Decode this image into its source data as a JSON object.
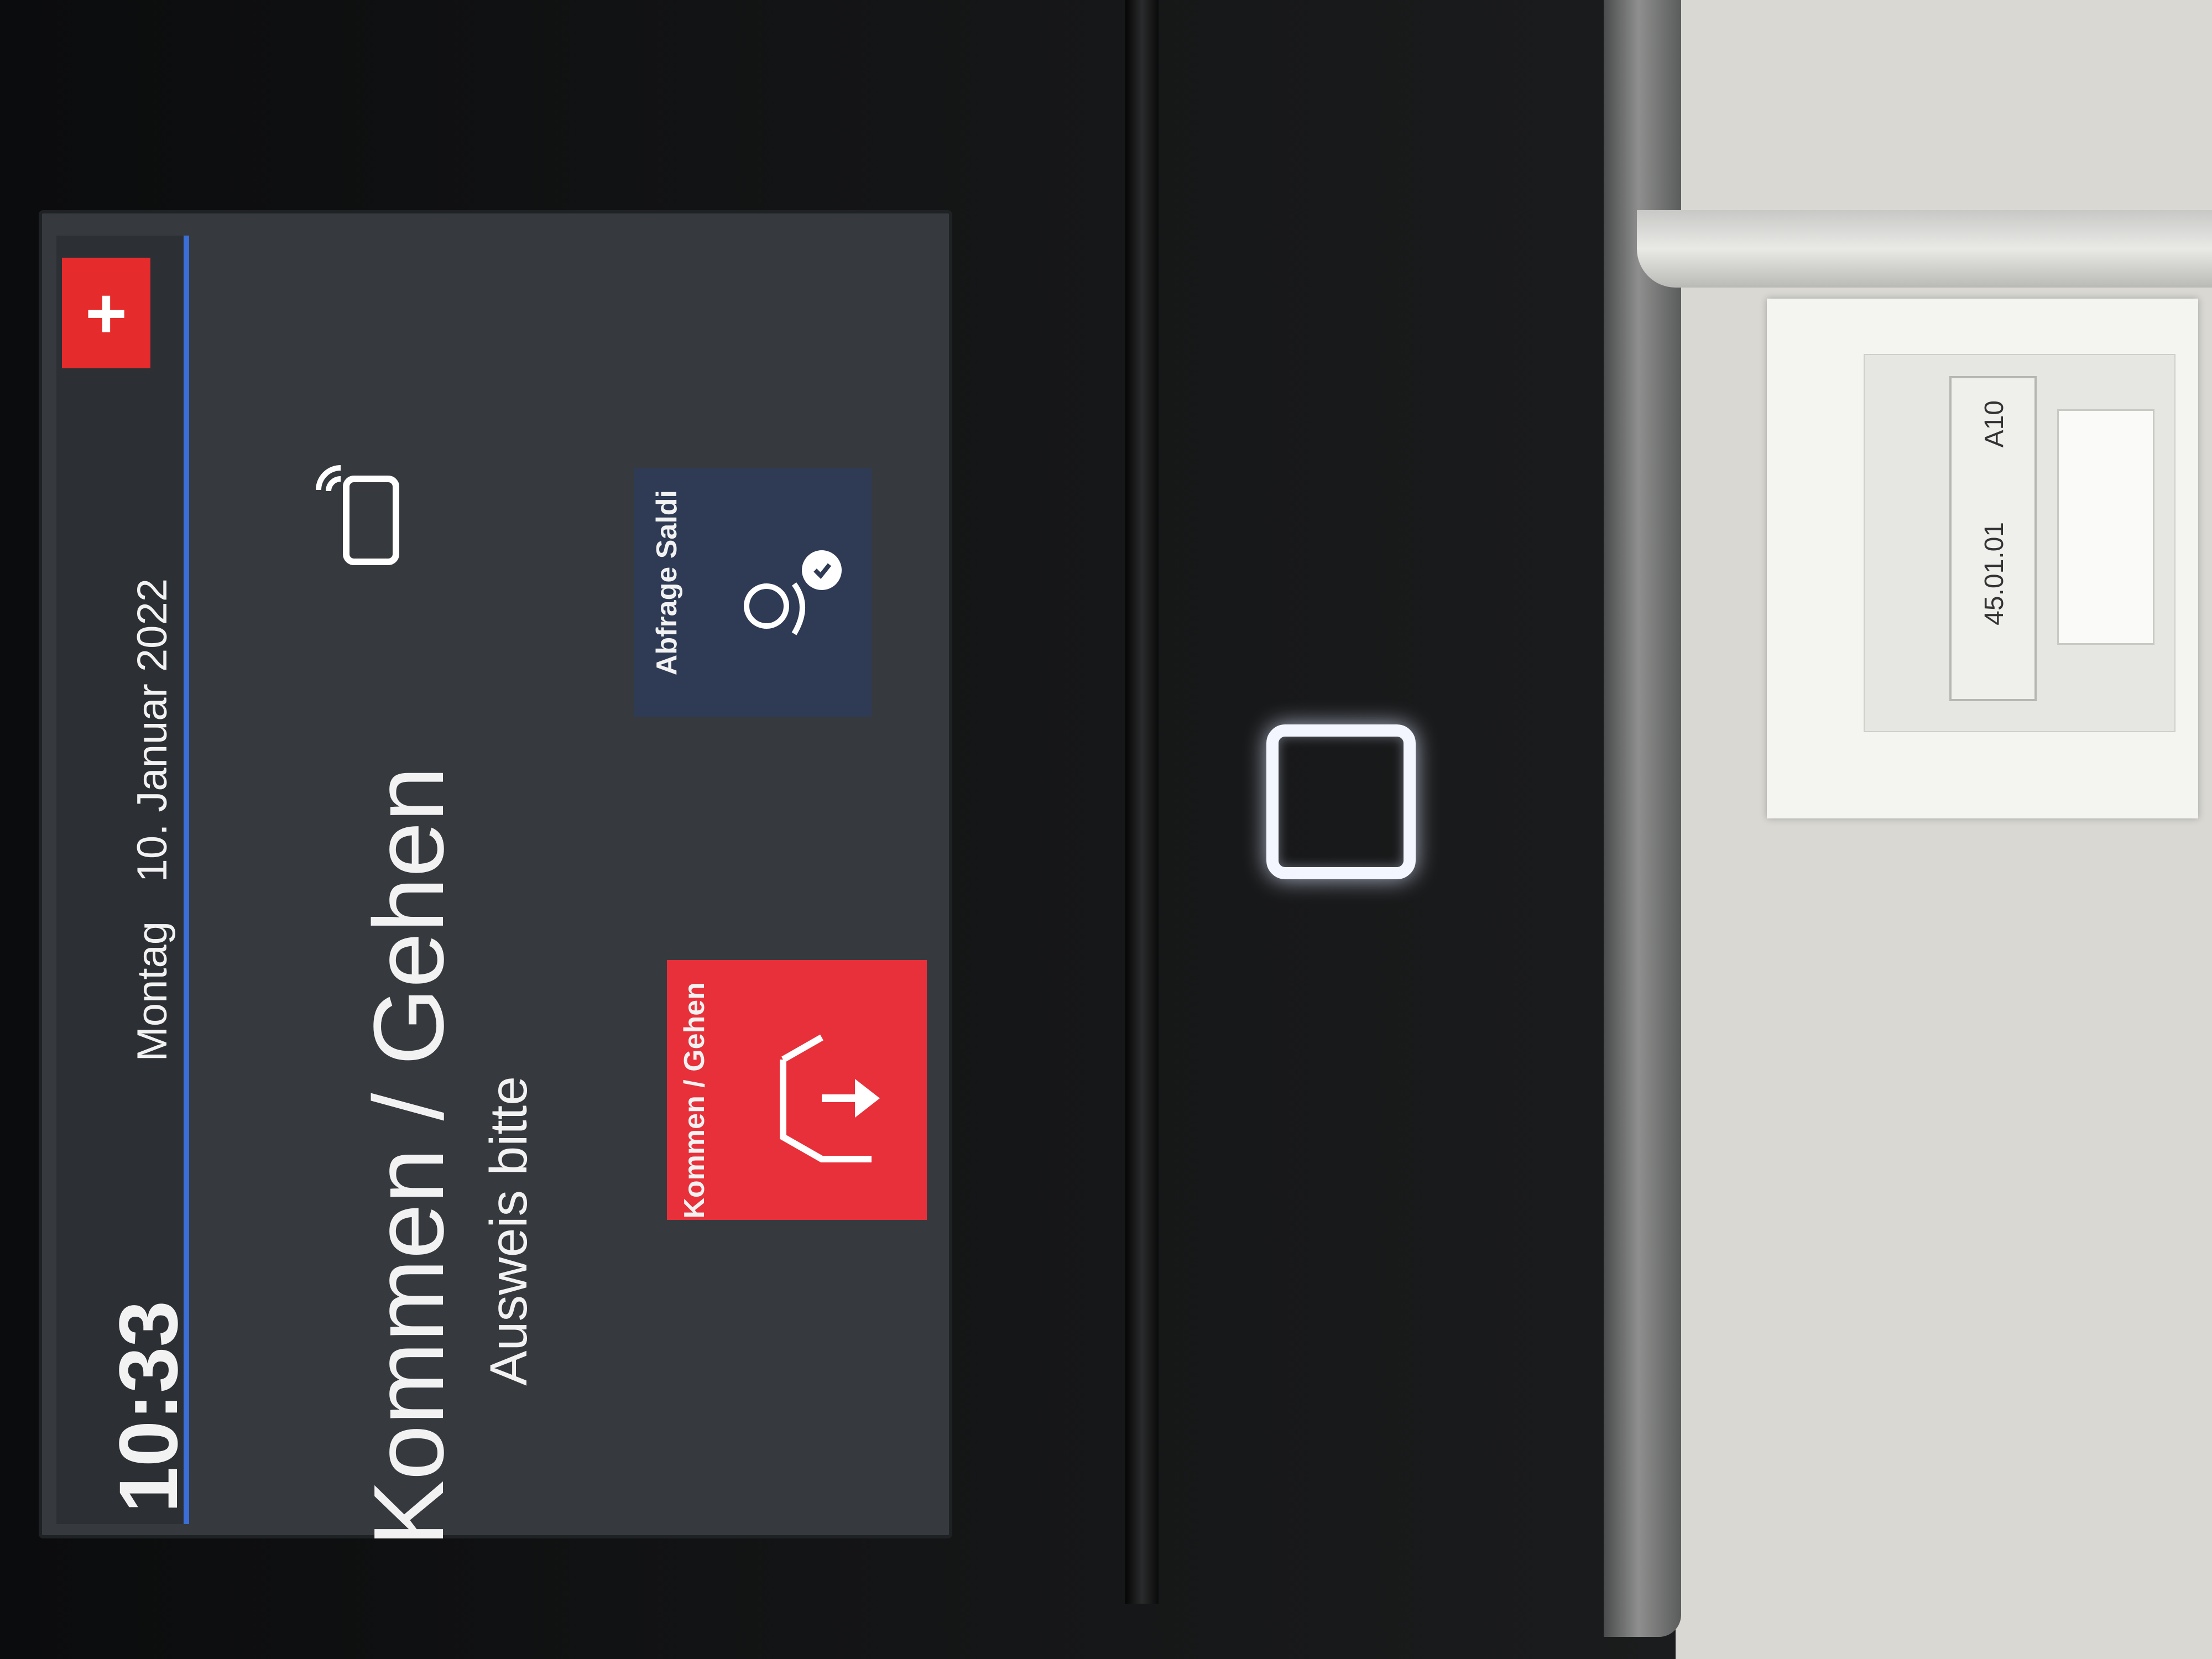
{
  "status": {
    "time": "10:33",
    "weekday": "Montag",
    "date": "10. Januar 2022"
  },
  "main": {
    "title": "Kommen / Gehen",
    "subtitle": "Ausweis bitte"
  },
  "buttons": {
    "balance": "Abfrage Saldi",
    "checkin": "Kommen / Gehen"
  },
  "outlet": {
    "label_a": "A10",
    "label_b": "45.01.01"
  },
  "colors": {
    "accent_red": "#e8303a",
    "accent_blue": "#3b6ed6",
    "button_navy": "#2f3b55"
  },
  "icons": [
    "swiss-flag-icon",
    "contactless-card-icon",
    "user-clock-icon",
    "exit-arrow-icon",
    "card-reader-icon"
  ]
}
